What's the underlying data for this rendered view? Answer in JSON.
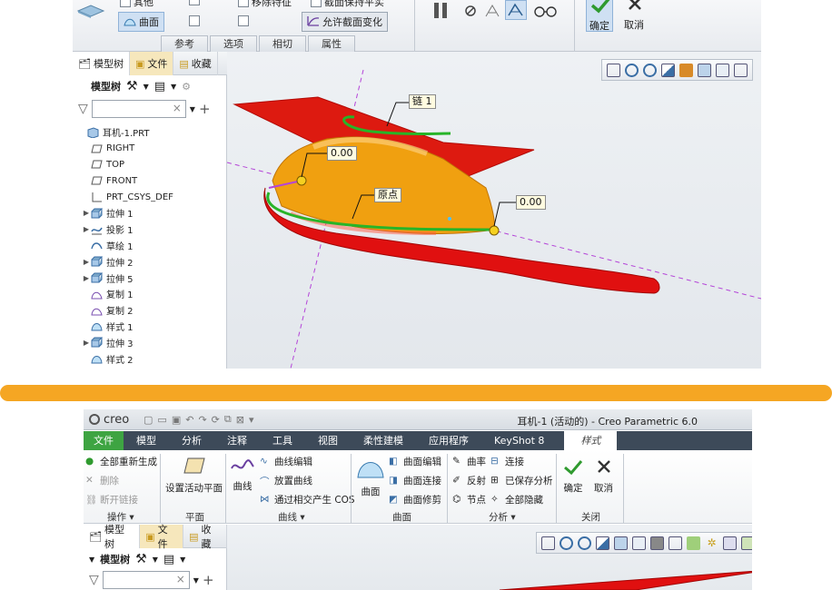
{
  "top": {
    "ribbon": {
      "row1": [
        "其他",
        "移除特征",
        "截面保持平实"
      ],
      "surface_btn": "曲面",
      "allow_section_change": "允许截面变化",
      "group_tabs": [
        "参考",
        "选项",
        "相切",
        "属性"
      ],
      "ok": "确定",
      "cancel": "取消"
    },
    "panel_tabs": [
      "模型树",
      "文件",
      "收藏"
    ],
    "tree_header": "模型树",
    "tree_items": [
      {
        "label": "耳机-1.PRT",
        "expand": "",
        "icon": "part-icon",
        "indent": 0
      },
      {
        "label": "RIGHT",
        "expand": "",
        "icon": "datum-plane-icon",
        "indent": 1
      },
      {
        "label": "TOP",
        "expand": "",
        "icon": "datum-plane-icon",
        "indent": 1
      },
      {
        "label": "FRONT",
        "expand": "",
        "icon": "datum-plane-icon",
        "indent": 1
      },
      {
        "label": "PRT_CSYS_DEF",
        "expand": "",
        "icon": "csys-icon",
        "indent": 1
      },
      {
        "label": "拉伸 1",
        "expand": "▶",
        "icon": "extrude-icon",
        "indent": 1
      },
      {
        "label": "投影 1",
        "expand": "▶",
        "icon": "projection-icon",
        "indent": 1
      },
      {
        "label": "草绘 1",
        "expand": "",
        "icon": "sketch-icon",
        "indent": 1
      },
      {
        "label": "拉伸 2",
        "expand": "▶",
        "icon": "extrude-icon",
        "indent": 1
      },
      {
        "label": "拉伸 5",
        "expand": "▶",
        "icon": "extrude-icon",
        "indent": 1
      },
      {
        "label": "复制 1",
        "expand": "",
        "icon": "copy-icon",
        "indent": 1
      },
      {
        "label": "复制 2",
        "expand": "",
        "icon": "copy-icon",
        "indent": 1
      },
      {
        "label": "样式 1",
        "expand": "",
        "icon": "style-icon",
        "indent": 1
      },
      {
        "label": "拉伸 3",
        "expand": "▶",
        "icon": "extrude-icon",
        "indent": 1
      },
      {
        "label": "样式 2",
        "expand": "",
        "icon": "style-icon",
        "indent": 1
      }
    ],
    "labels": {
      "chain": "链 1",
      "dim1": "0.00",
      "origin": "原点",
      "dim2": "0.00"
    }
  },
  "bottom": {
    "logo": "creo",
    "window_title": "耳机-1 (活动的) - Creo Parametric 6.0",
    "tabs": [
      "文件",
      "模型",
      "分析",
      "注释",
      "工具",
      "视图",
      "柔性建模",
      "应用程序",
      "KeyShot 8",
      "样式"
    ],
    "ops": {
      "regen_all": "全部重新生成",
      "delete": "删除",
      "break_link": "断开链接",
      "group": "操作"
    },
    "plane": {
      "set_active": "设置活动平面",
      "group": "平面"
    },
    "curve": {
      "curve": "曲线",
      "edit_curve": "曲线编辑",
      "drop_curve": "放置曲线",
      "cos": "通过相交产生 COS",
      "group": "曲线"
    },
    "surface": {
      "surface": "曲面",
      "edit": "曲面编辑",
      "connect": "曲面连接",
      "trim": "曲面修剪",
      "group": "曲面"
    },
    "analysis": {
      "curvature": "曲率",
      "connect": "连接",
      "reflect": "反射",
      "saved": "已保存分析",
      "node": "节点",
      "hide_all": "全部隐藏",
      "group": "分析"
    },
    "close": {
      "ok": "确定",
      "cancel": "取消",
      "group": "关闭"
    },
    "panel_tabs": [
      "模型树",
      "文件",
      "收藏"
    ],
    "tree_header": "模型树"
  },
  "colors": {
    "divider": "#f5a623",
    "file_tab": "#3ea442",
    "tab_bar": "#3d4a59",
    "surface_orange": "#f0a010",
    "surface_red": "#e01010",
    "curve_green": "#28b428"
  }
}
